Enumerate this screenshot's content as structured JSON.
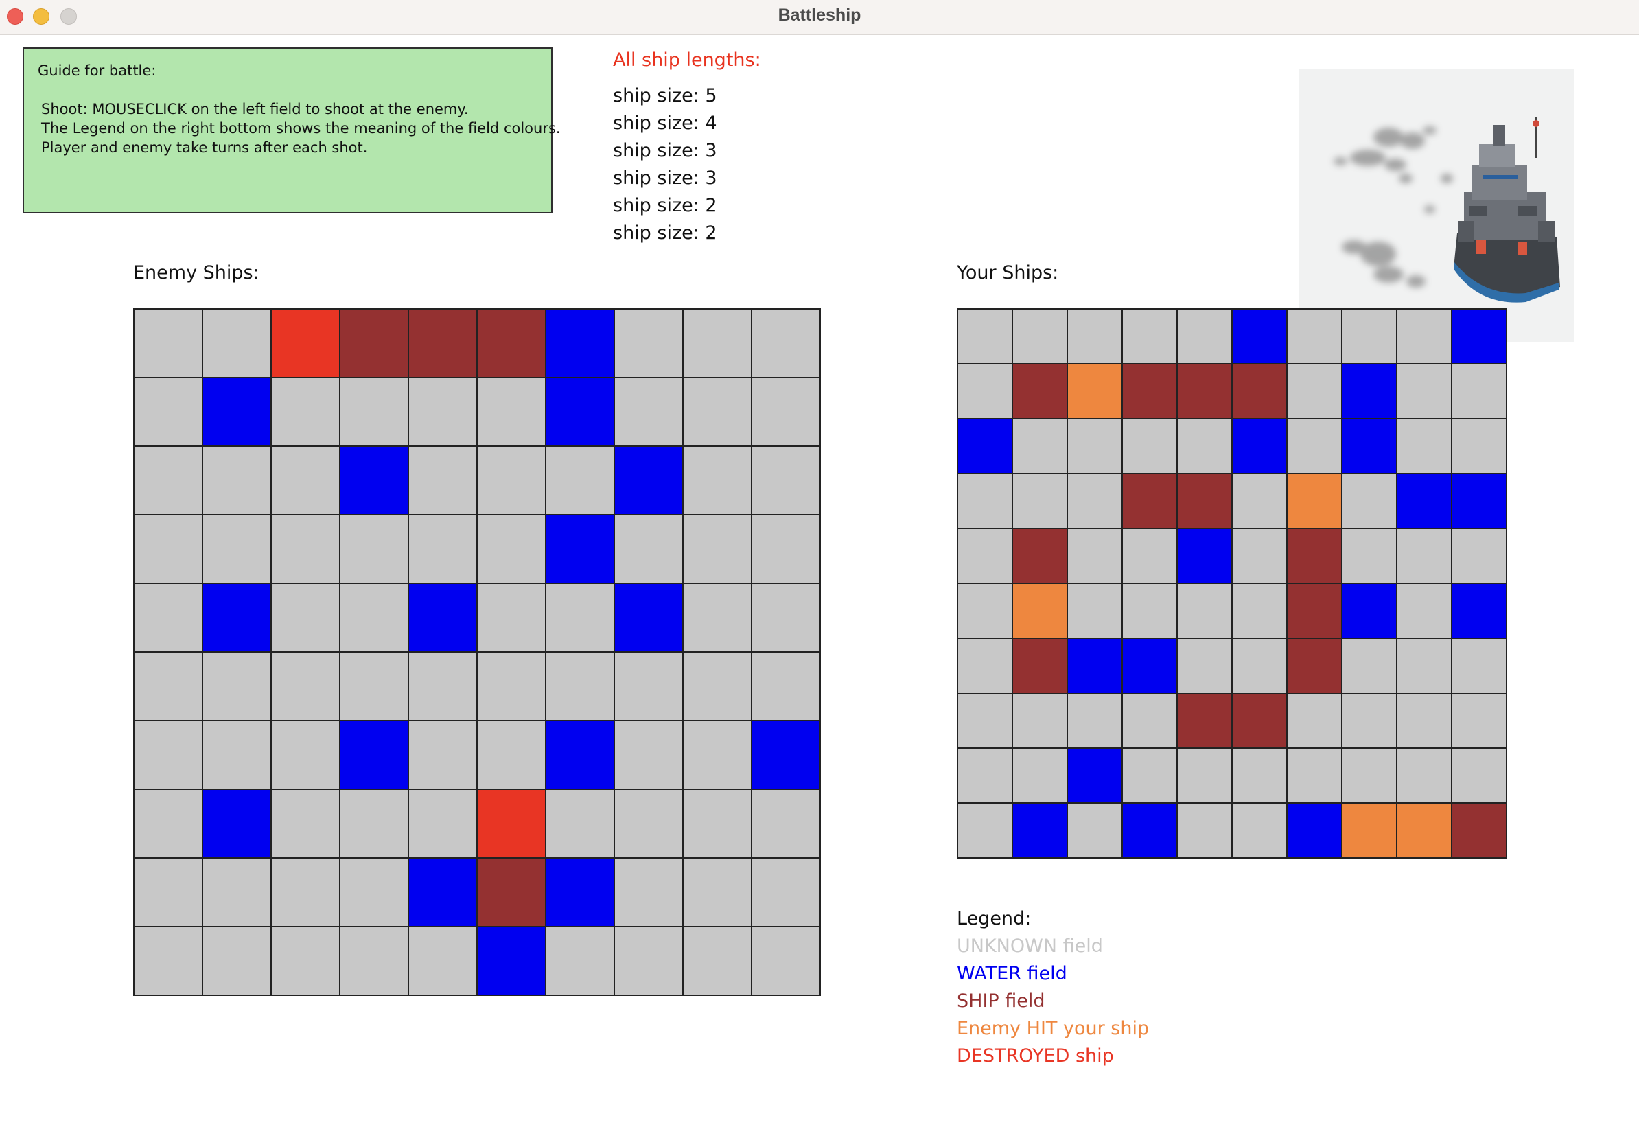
{
  "window": {
    "title": "Battleship"
  },
  "guide": {
    "heading": "Guide for battle:",
    "lines": [
      "Shoot: MOUSECLICK on the left field to shoot at the enemy.",
      "The Legend on the right bottom shows the meaning of the field colours.",
      "Player and enemy take turns after each shot."
    ]
  },
  "ship_lengths": {
    "title": "All ship lengths:",
    "items": [
      "ship size: 5",
      "ship size: 4",
      "ship size: 3",
      "ship size: 3",
      "ship size: 2",
      "ship size: 2"
    ]
  },
  "colors": {
    "U": "#c8c8c8",
    "W": "#0000f0",
    "S": "#943131",
    "H": "#ee873f",
    "D": "#e83524"
  },
  "enemy_board": {
    "label": "Enemy Ships:",
    "rows": [
      "UUDSSSWUUU",
      "UWUUUUWUUU",
      "UUUWUUUWUU",
      "UUUUUUWUUU",
      "UWUUWUUWUU",
      "UUUUUUUUUU",
      "UUUWUUWUUW",
      "UWUUUDUUUU",
      "UUUUWSWUUU",
      "UUUUUWUUUU"
    ]
  },
  "your_board": {
    "label": "Your Ships:",
    "rows": [
      "UUUUUWUUUW",
      "USHSSSUWUU",
      "WUUUUWUWUU",
      "UUUSSUHUWW",
      "USUUWUSUUU",
      "UHUUUUSWUW",
      "USWWUUSUUU",
      "UUUUSSUUUU",
      "UUWUUUUUUU",
      "UWUWUUWHHS"
    ]
  },
  "legend": {
    "title": "Legend:",
    "items": [
      {
        "label": "UNKNOWN field",
        "color": "#c8c8c8"
      },
      {
        "label": "WATER field",
        "color": "#0000f0"
      },
      {
        "label": "SHIP field",
        "color": "#943131"
      },
      {
        "label": "Enemy HIT your ship",
        "color": "#ee873f"
      },
      {
        "label": "DESTROYED ship",
        "color": "#e83524"
      }
    ]
  },
  "icons": {
    "ship_image": "battleship-illustration-icon"
  }
}
